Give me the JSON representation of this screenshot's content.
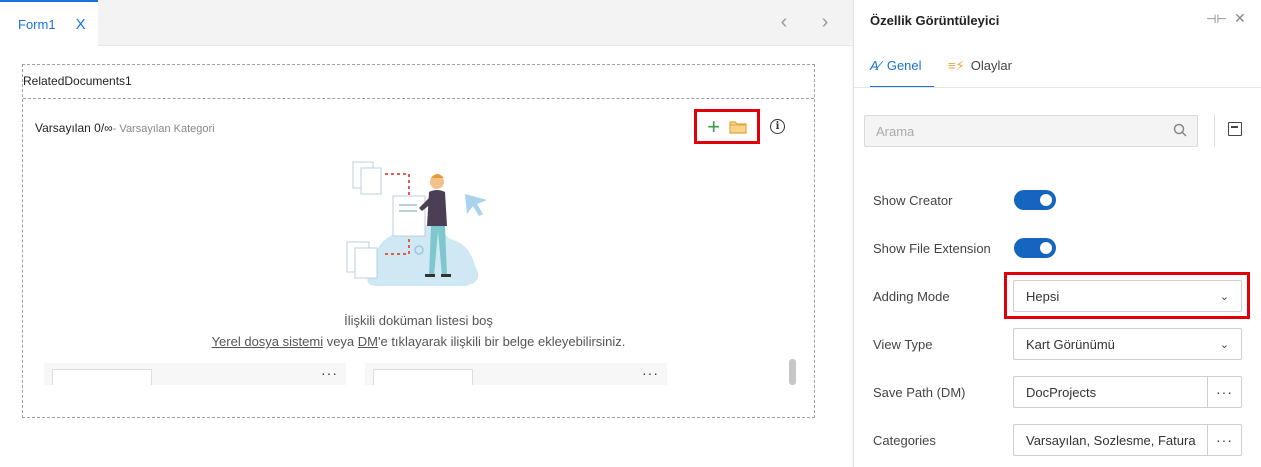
{
  "designer": {
    "tab_label": "Form1",
    "tab_close": "X",
    "nav_prev": "‹",
    "nav_next": "›",
    "control_title": "RelatedDocuments1",
    "header_main": "Varsayılan 0/∞",
    "header_sub": "- Varsayılan Kategori",
    "add_icon": "+",
    "info_icon": "i",
    "empty_title": "İlişkili doküman listesi boş",
    "empty_desc_link1": "Yerel dosya sistemi",
    "empty_desc_mid": " veya ",
    "empty_desc_link2": "DM",
    "empty_desc_end": "'e tıklayarak ilişkili bir belge ekleyebilirsiniz.",
    "card_dots": "···"
  },
  "panel": {
    "title": "Özellik Görüntüleyici",
    "pin_icon": "⊣⊢",
    "close_icon": "✕",
    "tabs": [
      {
        "label": "Genel",
        "icon": "A⁄"
      },
      {
        "label": "Olaylar",
        "icon": "≡⚡"
      }
    ],
    "search_placeholder": "Arama",
    "properties": {
      "show_creator": {
        "label": "Show Creator",
        "value": "on"
      },
      "show_file_extension": {
        "label": "Show File Extension",
        "value": "on"
      },
      "adding_mode": {
        "label": "Adding Mode",
        "value": "Hepsi"
      },
      "view_type": {
        "label": "View Type",
        "value": "Kart Görünümü"
      },
      "save_path": {
        "label": "Save Path (DM)",
        "value": "DocProjects",
        "button": "···"
      },
      "categories": {
        "label": "Categories",
        "value": "Varsayılan, Sozlesme, Fatura",
        "button": "···"
      }
    },
    "chevron": "⌄"
  },
  "colors": {
    "accent": "#1a73d9",
    "toggle_on": "#1565c0",
    "highlight": "#e0000a",
    "add_green": "#3a9b45",
    "folder_orange": "#e8a33c"
  }
}
